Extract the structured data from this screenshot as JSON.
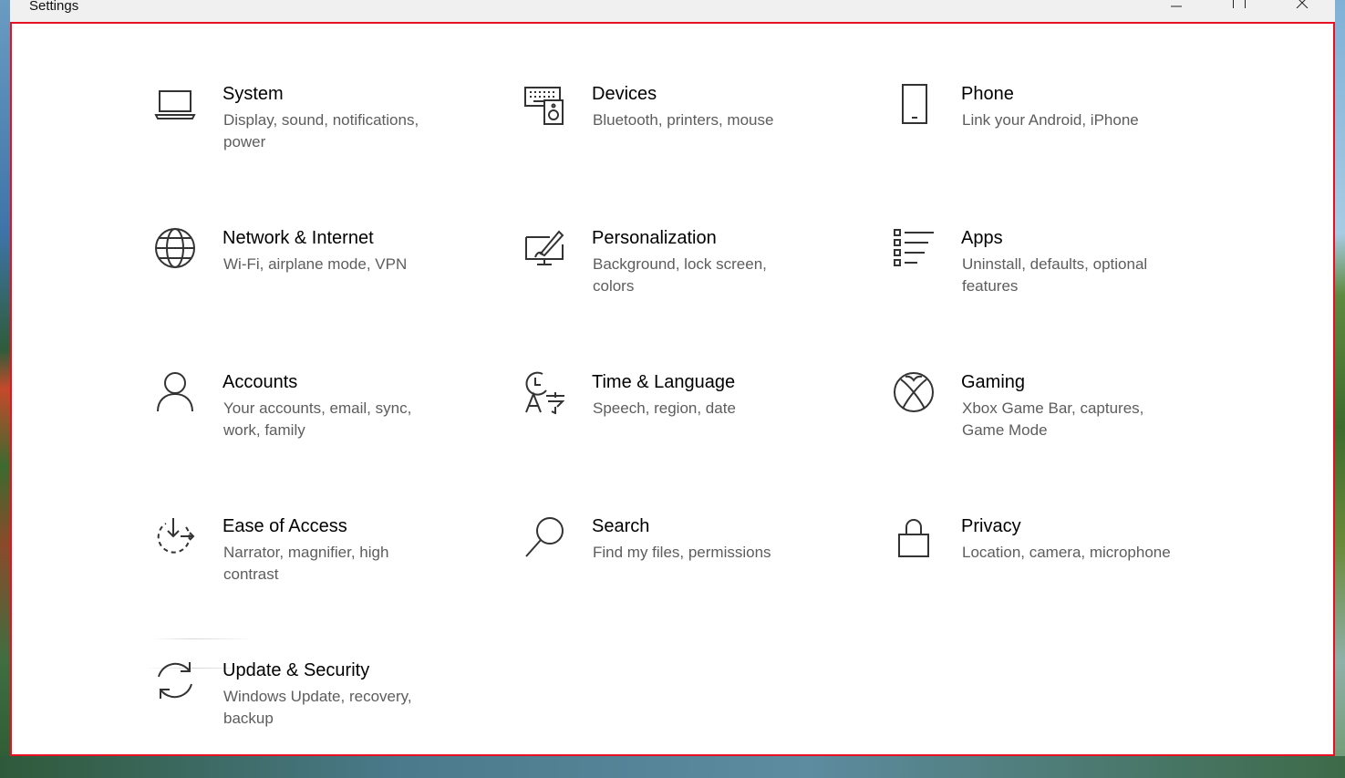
{
  "window": {
    "title": "Settings"
  },
  "categories": [
    {
      "name": "System",
      "desc": "Display, sound, notifications, power",
      "icon": "laptop-icon"
    },
    {
      "name": "Devices",
      "desc": "Bluetooth, printers, mouse",
      "icon": "devices-icon"
    },
    {
      "name": "Phone",
      "desc": "Link your Android, iPhone",
      "icon": "phone-icon"
    },
    {
      "name": "Network & Internet",
      "desc": "Wi-Fi, airplane mode, VPN",
      "icon": "globe-icon"
    },
    {
      "name": "Personalization",
      "desc": "Background, lock screen, colors",
      "icon": "paintbrush-icon"
    },
    {
      "name": "Apps",
      "desc": "Uninstall, defaults, optional features",
      "icon": "apps-list-icon"
    },
    {
      "name": "Accounts",
      "desc": "Your accounts, email, sync, work, family",
      "icon": "person-icon"
    },
    {
      "name": "Time & Language",
      "desc": "Speech, region, date",
      "icon": "time-language-icon"
    },
    {
      "name": "Gaming",
      "desc": "Xbox Game Bar, captures, Game Mode",
      "icon": "xbox-icon"
    },
    {
      "name": "Ease of Access",
      "desc": "Narrator, magnifier, high contrast",
      "icon": "ease-of-access-icon"
    },
    {
      "name": "Search",
      "desc": "Find my files, permissions",
      "icon": "search-icon"
    },
    {
      "name": "Privacy",
      "desc": "Location, camera, microphone",
      "icon": "lock-icon"
    },
    {
      "name": "Update & Security",
      "desc": "Windows Update, recovery, backup",
      "icon": "sync-icon"
    }
  ],
  "colors": {
    "frame_border": "#e81123",
    "icon_stroke": "#333333",
    "desc_text": "#5d5d5d"
  }
}
